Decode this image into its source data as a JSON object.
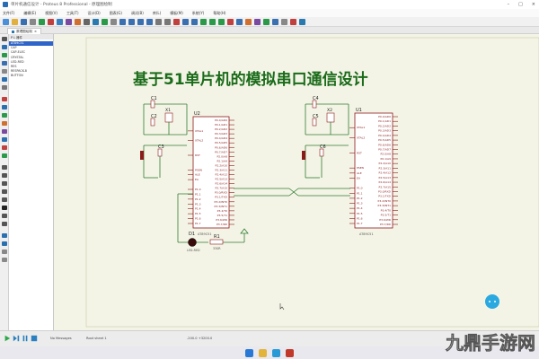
{
  "window": {
    "title": "单片机通信设计 - Proteus 8 Professional - 原理图绘制"
  },
  "menu": [
    "文件(F)",
    "编辑(E)",
    "视图(V)",
    "工具(T)",
    "设计(D)",
    "图表(G)",
    "调试(B)",
    "库(L)",
    "模板(M)",
    "系统(Y)",
    "帮助(H)"
  ],
  "tab": {
    "label": "原理图绘制"
  },
  "side_panel": {
    "header": "P  L  器件",
    "devices": [
      "AT89C51",
      "CAP",
      "CAP-ELEC",
      "CRYSTAL",
      "LED-RED",
      "RES",
      "RESPACK-8",
      "BUTTON"
    ],
    "selected_index": 0
  },
  "schematic": {
    "title": "基于51单片机的模拟串口通信设计",
    "left_chip": {
      "ref": "U2",
      "part": "AT89C51"
    },
    "right_chip": {
      "ref": "U1",
      "part": "AT89C51"
    },
    "left_caps": [
      "C1",
      "C2",
      "C3"
    ],
    "right_caps": [
      "C4",
      "C5",
      "C6"
    ],
    "left_x": "X1",
    "right_x": "X2",
    "led": {
      "ref": "D1",
      "part": "LED-RED"
    },
    "resistor": {
      "ref": "R1",
      "value": "330R"
    },
    "pins_left": [
      "XTAL1",
      "XTAL2",
      "RST",
      "PSEN",
      "ALE",
      "EA",
      "P1.0",
      "P1.1",
      "P1.2",
      "P1.3",
      "P1.4",
      "P1.5",
      "P1.6",
      "P1.7"
    ],
    "pins_right": [
      "P0.0/AD0",
      "P0.1/AD1",
      "P0.2/AD2",
      "P0.3/AD3",
      "P0.4/AD4",
      "P0.5/AD5",
      "P0.6/AD6",
      "P0.7/AD7",
      "P2.0/A8",
      "P2.1/A9",
      "P2.2/A10",
      "P2.3/A11",
      "P2.4/A12",
      "P2.5/A13",
      "P2.6/A14",
      "P2.7/A15",
      "P3.0/RXD",
      "P3.1/TXD",
      "P3.2/INT0",
      "P3.3/INT1",
      "P3.4/T0",
      "P3.5/T1",
      "P3.6/WR",
      "P3.7/RD"
    ]
  },
  "status": {
    "message": "No Messages",
    "sheet": "Root sheet 1",
    "coords": "-200.0   +3200.0"
  },
  "watermark": "九鼎手游网",
  "colors": {
    "canvas": "#f4f4e6",
    "wire": "#2e7d32",
    "chip_border": "#8b1a1a",
    "chip_fill": "#ffffff",
    "title": "#1a6b1a",
    "pin": "#8b1a1a"
  }
}
